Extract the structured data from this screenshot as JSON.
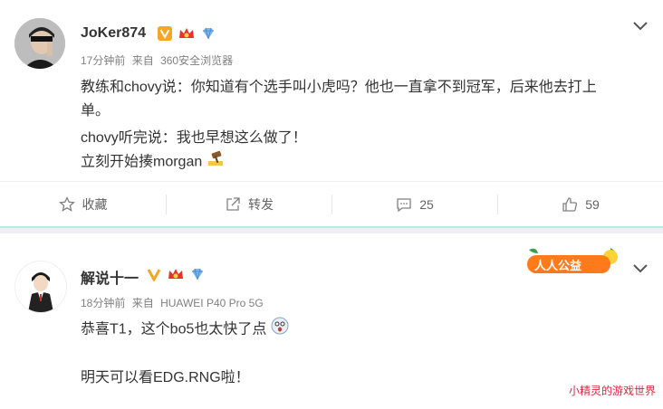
{
  "posts": [
    {
      "username": "JoKer874",
      "time": "17分钟前",
      "source_prefix": "来自",
      "source": "360安全浏览器",
      "lines": [
        "教练和chovy说：你知道有个选手叫小虎吗？他也一直拿不到冠军，后来他去打上",
        "单。",
        "chovy听完说：我也早想这么做了！",
        "立刻开始揍morgan"
      ],
      "actions": {
        "favorite_label": "收藏",
        "repost_label": "转发",
        "comment_count": "25",
        "like_count": "59"
      }
    },
    {
      "username": "解说十一",
      "time": "18分钟前",
      "source_prefix": "来自",
      "source": "HUAWEI P40 Pro 5G",
      "lines": [
        "恭喜T1，这个bo5也太快了点",
        "",
        "明天可以看EDG.RNG啦！"
      ],
      "badge_text": "人人公益"
    }
  ],
  "watermark": "小精灵的游戏世界",
  "colors": {
    "verified_orange": "#f5a623",
    "vip_red": "#e8332a",
    "link_gray": "#808080",
    "accent_band": "#b9e9ea"
  },
  "icons": [
    "verified-v-icon",
    "vip-crown-icon",
    "diamond-icon",
    "star-icon",
    "share-icon",
    "comment-icon",
    "like-icon",
    "chevron-down-icon"
  ]
}
